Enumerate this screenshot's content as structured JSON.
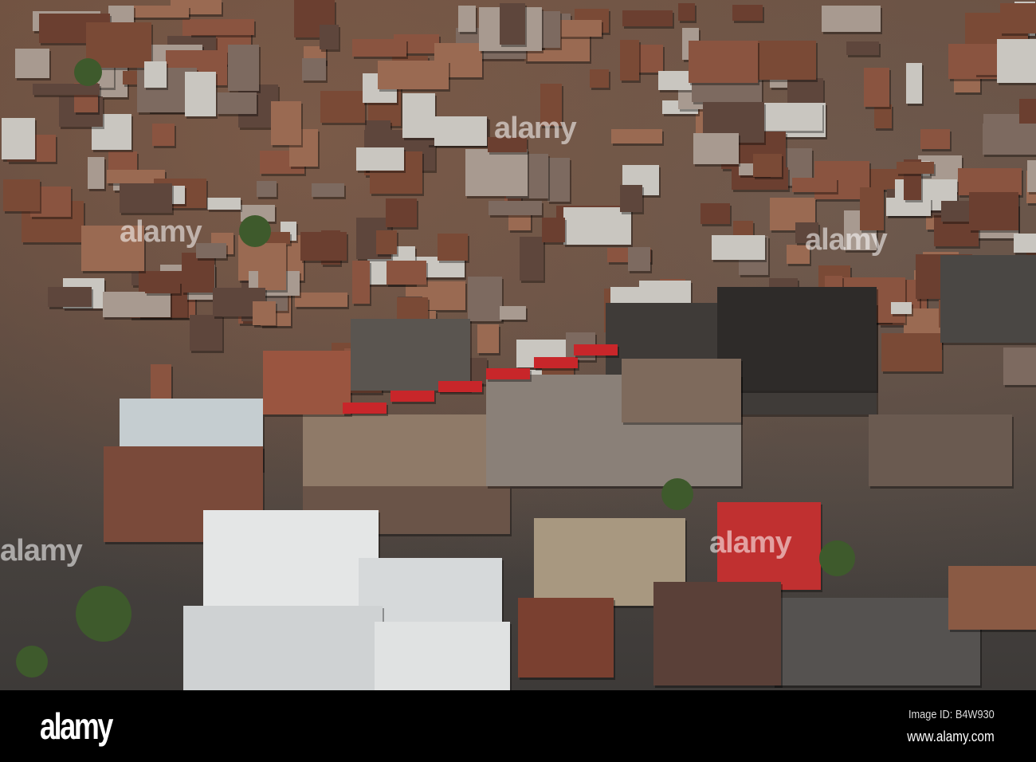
{
  "photo": {
    "subject": "aerial-city-centre",
    "watermark_text": "alamy"
  },
  "footer": {
    "logo": "alamy",
    "image_id": "Image ID: B4W930",
    "site": "www.alamy.com"
  },
  "colors": {
    "roof_brown": "#7a4a36",
    "roof_grey": "#6d6c6a",
    "roof_white": "#d9dcdc",
    "bus_red": "#c8262a",
    "tree_green": "#3e5a2c"
  }
}
